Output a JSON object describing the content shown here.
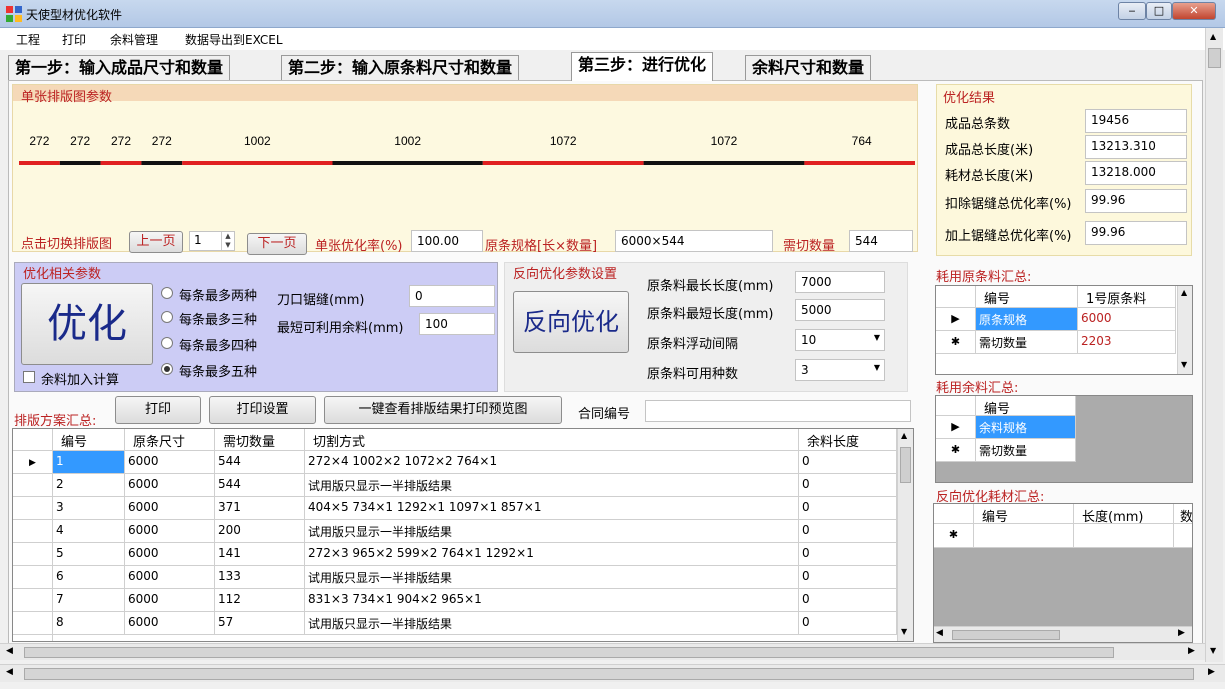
{
  "window": {
    "title": "天使型材优化软件",
    "min": "‒",
    "max": "□",
    "close": "✕"
  },
  "menu": [
    "工程",
    "打印",
    "余料管理",
    "数据导出到EXCEL"
  ],
  "tabs": [
    "第一步：输入成品尺寸和数量",
    "第二步：输入原条料尺寸和数量",
    "第三步：进行优化",
    "余料尺寸和数量"
  ],
  "layout_panel": {
    "title": "单张排版图参数",
    "segments": [
      {
        "label": "272",
        "color": "#e02020",
        "value": 272
      },
      {
        "label": "272",
        "color": "#111111",
        "value": 272
      },
      {
        "label": "272",
        "color": "#e02020",
        "value": 272
      },
      {
        "label": "272",
        "color": "#111111",
        "value": 272
      },
      {
        "label": "1002",
        "color": "#e02020",
        "value": 1002
      },
      {
        "label": "1002",
        "color": "#111111",
        "value": 1002
      },
      {
        "label": "1072",
        "color": "#e02020",
        "value": 1072
      },
      {
        "label": "1072",
        "color": "#111111",
        "value": 1072
      },
      {
        "label": "764",
        "color": "#e02020",
        "value": 764
      }
    ],
    "switch_label": "点击切换排版图",
    "prev": "上一页",
    "page": "1",
    "next": "下一页",
    "rate_label": "单张优化率(%)",
    "rate": "100.00",
    "spec_label": "原条规格[长×数量]",
    "spec": "6000×544",
    "need_label": "需切数量",
    "need": "544"
  },
  "opt_params": {
    "title": "优化相关参数",
    "button": "优化",
    "radios": [
      "每条最多两种",
      "每条最多三种",
      "每条最多四种",
      "每条最多五种"
    ],
    "selected": 3,
    "kerf_label": "刀口锯缝(mm)",
    "kerf": "0",
    "minrem_label": "最短可利用余料(mm)",
    "minrem": "100",
    "check_label": "余料加入计算"
  },
  "reverse": {
    "title": "反向优化参数设置",
    "button": "反向优化",
    "max_label": "原条料最长长度(mm)",
    "max": "7000",
    "min_label": "原条料最短长度(mm)",
    "min": "5000",
    "step_label": "原条料浮动间隔",
    "step": "10",
    "kinds_label": "原条料可用种数",
    "kinds": "3"
  },
  "plan": {
    "title": "排版方案汇总:",
    "print": "打印",
    "print_setup": "打印设置",
    "preview": "一键查看排版结果打印预览图",
    "contract_label": "合同编号",
    "contract": "",
    "headers": [
      "编号",
      "原条尺寸",
      "需切数量",
      "切割方式",
      "余料长度"
    ],
    "rows": [
      [
        "1",
        "6000",
        "544",
        "272×4 1002×2 1072×2 764×1",
        "0"
      ],
      [
        "2",
        "6000",
        "544",
        " 试用版只显示一半排版结果",
        "0"
      ],
      [
        "3",
        "6000",
        "371",
        "404×5 734×1 1292×1 1097×1 857×1",
        "0"
      ],
      [
        "4",
        "6000",
        "200",
        " 试用版只显示一半排版结果",
        "0"
      ],
      [
        "5",
        "6000",
        "141",
        "272×3 965×2 599×2 764×1 1292×1",
        "0"
      ],
      [
        "6",
        "6000",
        "133",
        " 试用版只显示一半排版结果",
        "0"
      ],
      [
        "7",
        "6000",
        "112",
        "831×3 734×1 904×2 965×1",
        "0"
      ],
      [
        "8",
        "6000",
        "57",
        " 试用版只显示一半排版结果",
        "0"
      ]
    ]
  },
  "results": {
    "title": "优化结果",
    "items": [
      {
        "label": "成品总条数",
        "value": "19456"
      },
      {
        "label": "成品总长度(米)",
        "value": "13213.310"
      },
      {
        "label": "耗材总长度(米)",
        "value": "13218.000"
      },
      {
        "label": "扣除锯缝总优化率(%)",
        "value": "99.96"
      },
      {
        "label": "加上锯缝总优化率(%)",
        "value": "99.96"
      }
    ]
  },
  "raw_summary": {
    "title": "耗用原条料汇总:",
    "headers": [
      "编号",
      "1号原条料"
    ],
    "rows": [
      [
        "原条规格",
        "6000"
      ],
      [
        "需切数量",
        "2203"
      ]
    ]
  },
  "rem_summary": {
    "title": "耗用余料汇总:",
    "headers": [
      "编号"
    ],
    "rows": [
      [
        "余料规格"
      ],
      [
        "需切数量"
      ]
    ]
  },
  "rev_summary": {
    "title": "反向优化耗材汇总:",
    "headers": [
      "编号",
      "长度(mm)",
      "数"
    ]
  },
  "colors": {
    "accent_red": "#b22222",
    "selection": "#3399ff",
    "result_panel": "#fdf8dc",
    "opt_panel": "#ccccf5",
    "layout_bg": "#fdf9e0"
  }
}
